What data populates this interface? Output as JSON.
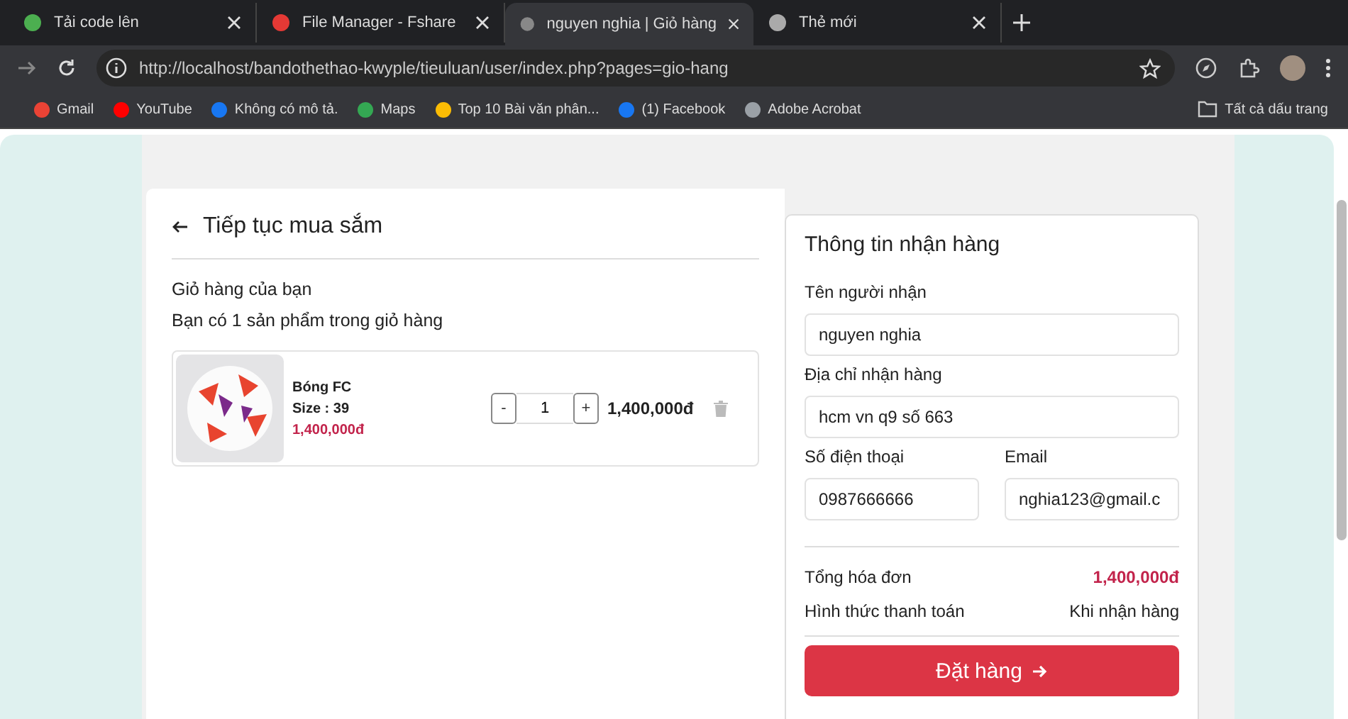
{
  "browser": {
    "tabs": [
      {
        "title": "Tải code lên",
        "selected": false
      },
      {
        "title": "File Manager - Fshare",
        "selected": false
      },
      {
        "title": "nguyen nghia | Giỏ hàng",
        "selected": true
      },
      {
        "title": "Thẻ mới",
        "selected": false
      }
    ],
    "address": "http://localhost/bandothethao-kwyple/tieuluan/user/index.php?pages=gio-hang",
    "bookmarks": [
      "Gmail",
      "YouTube",
      "Không có mô tả.",
      "Maps",
      "Top 10 Bài văn phân...",
      "(1) Facebook",
      "Adobe Acrobat"
    ],
    "all_bookmarks": "Tất cả dấu trang"
  },
  "cart": {
    "back_link": "Tiếp tục mua sắm",
    "heading": "Giỏ hàng của bạn",
    "summary": "Bạn có 1 sản phẩm trong giỏ hàng",
    "items": [
      {
        "name": "Bóng FC",
        "size": "Size : 39",
        "price": "1,400,000đ",
        "minus": "-",
        "quantity": "1",
        "plus": "+",
        "total": "1,400,000đ"
      }
    ]
  },
  "checkout": {
    "title": "Thông tin nhận hàng",
    "fields": [
      {
        "label": "Tên người nhận",
        "value": "nguyen nghia",
        "kind": "full"
      },
      {
        "label": "Địa chỉ nhận hàng",
        "value": "hcm vn q9 số 663",
        "kind": "full"
      },
      {
        "label": "Số điện thoại",
        "value": "0987666666",
        "kind": "half"
      },
      {
        "label": "Email",
        "value": "nghia123@gmail.c",
        "kind": "half"
      }
    ],
    "total_label": "Tổng hóa đơn",
    "total": "1,400,000đ",
    "payment_label": "Hình thức thanh toán",
    "payment": "Khi nhận hàng",
    "button": "Đặt hàng"
  }
}
